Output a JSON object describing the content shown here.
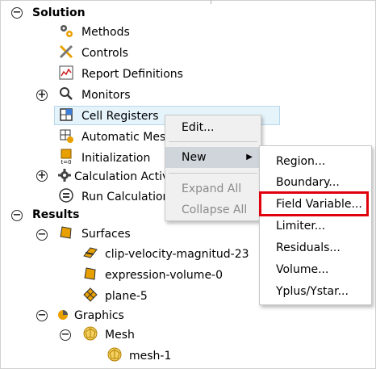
{
  "tree": {
    "solution": "Solution",
    "methods": "Methods",
    "controls": "Controls",
    "report_definitions": "Report Definitions",
    "monitors": "Monitors",
    "cell_registers": "Cell Registers",
    "automatic_mesh": "Automatic Mes",
    "initialization": "Initialization",
    "calculation_activities": "Calculation Activ",
    "run_calculation": "Run Calculation",
    "results": "Results",
    "surfaces": "Surfaces",
    "clip_velocity": "clip-velocity-magnitud-23",
    "expression_volume": "expression-volume-0",
    "plane": "plane-5",
    "graphics": "Graphics",
    "mesh": "Mesh",
    "mesh1": "mesh-1",
    "toggle_expand": "+",
    "toggle_collapse": "−"
  },
  "context_menu": {
    "edit": "Edit...",
    "new": "New",
    "expand_all": "Expand All",
    "collapse_all": "Collapse All",
    "submenu_arrow": "▶"
  },
  "submenu": {
    "region": "Region...",
    "boundary": "Boundary...",
    "field_variable": "Field Variable...",
    "limiter": "Limiter...",
    "residuals": "Residuals...",
    "volume": "Volume...",
    "yplus": "Yplus/Ystar..."
  },
  "colors": {
    "highlight_border": "#e0000d",
    "selection_bg": "#e5f3fb",
    "menu_bg": "#f0f0f0"
  }
}
